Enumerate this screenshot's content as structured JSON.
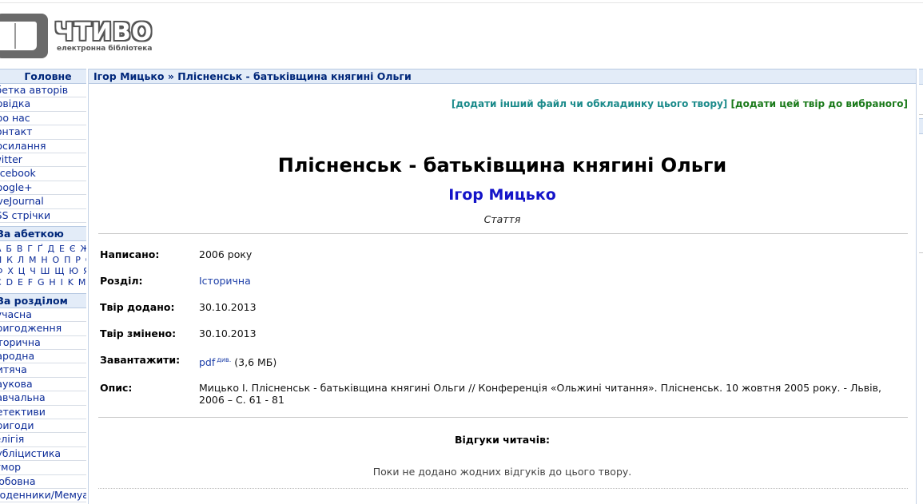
{
  "logo": {
    "title": "ЧТИВО",
    "subtitle": "електронна бібліотека"
  },
  "sidebar": {
    "main_head": "Головне",
    "main_items": [
      "Абетка авторів",
      "Довідка",
      "Про нас",
      "Контакт",
      "Посилання",
      "Twitter",
      "Facebook",
      "Google+",
      "LiveJournal",
      "RSS стрічки"
    ],
    "alpha_head": "За абеткою",
    "alpha_rows": [
      "А Б В Г Ґ Д Е Є Ж З І Ї",
      "Й К Л М Н О П Р С Т У",
      "Ф Х Ц Ч Ш Щ Ю Я A B",
      "C D E F G H I K M N P S U"
    ],
    "section_head": "За розділом",
    "section_items": [
      "Сучасна",
      "Пригодження",
      "Історична",
      "Народна",
      "Дитяча",
      "Наукова",
      "Навчальна",
      "Детективи",
      "Пригоди",
      "Релігія",
      "Публіцистика",
      "Гумор",
      "Любовна",
      "Щоденники/Мемуари"
    ]
  },
  "crumb": {
    "author": "Ігор Мицько",
    "sep": " » ",
    "work": "Плісненськ - батьківщина княгині Ольги"
  },
  "actions": {
    "add_file": "[додати інший файл чи обкладинку цього твору]",
    "add_fav": "[додати цей твір до вибраного]"
  },
  "work": {
    "title": "Плісненськ - батьківщина княгині Ольги",
    "author": "Ігор Мицько",
    "type": "Стаття"
  },
  "details": {
    "written_label": "Написано:",
    "written": "2006 року",
    "section_label": "Розділ:",
    "section": "Історична",
    "added_label": "Твір додано:",
    "added": "30.10.2013",
    "changed_label": "Твір змінено:",
    "changed": "30.10.2013",
    "download_label": "Завантажити:",
    "download_format": "pdf",
    "download_view": "див.",
    "download_size": "(3,6 МБ)",
    "desc_label": "Опис:",
    "desc": "Мицько І. Плісненськ - батьківщина княгині Ольги // Конференція «Ольжині читання». Плісненськ. 10 жовтня 2005 року. - Львів, 2006 – С. 61 - 81"
  },
  "reviews": {
    "heading": "Відгуки читачів:",
    "empty": "Поки не додано жодних відгуків до цього твору."
  }
}
